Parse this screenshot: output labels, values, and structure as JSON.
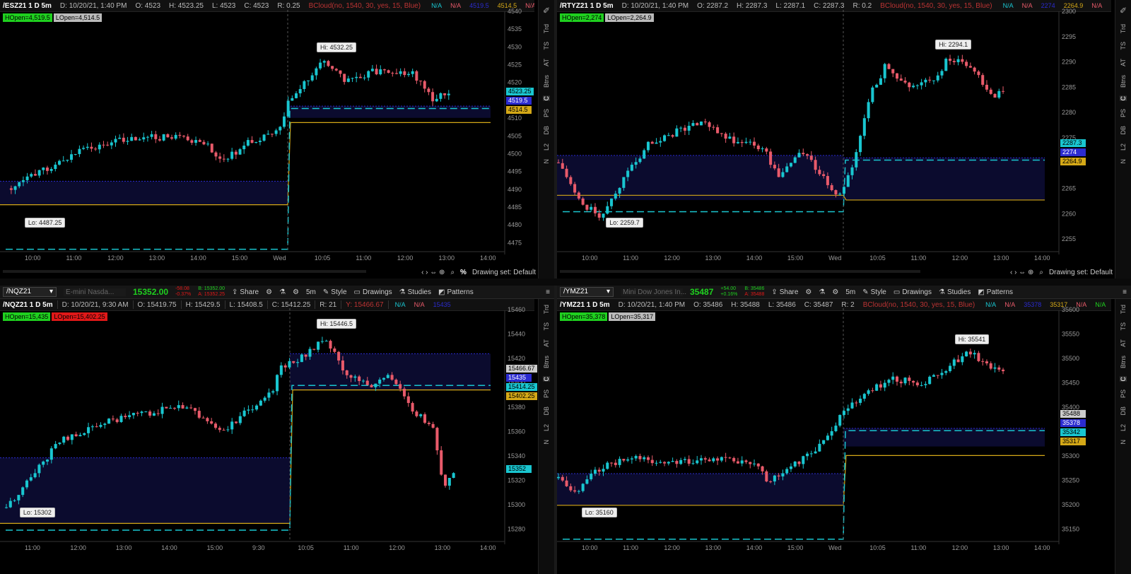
{
  "panels": [
    {
      "id": "es",
      "infobar": {
        "symbol": "/ESZ21 1 D 5m",
        "date": "D: 10/20/21, 1:40 PM",
        "open": "O: 4523",
        "high": "H: 4523.25",
        "low": "L: 4523",
        "close": "C: 4523",
        "range": "R: 0.25",
        "study": "BCloud(no, 1540, 30, yes, 15, Blue)",
        "na1": "N/A",
        "na2": "N/A",
        "val1": "4519.5",
        "val2": "4514.5",
        "na3": "N/A",
        "na4": "N/A",
        "na5": "N/A"
      },
      "badges": [
        {
          "text": "HOpen=4,519.5",
          "color": "#1fd01f"
        },
        {
          "text": "LOpen=4,514.5",
          "color": "#bbbbbb"
        }
      ],
      "y_ticks": [
        "4540",
        "4535",
        "4530",
        "4525",
        "4520",
        "4515",
        "4510",
        "4505",
        "4500",
        "4495",
        "4490",
        "4485",
        "4480",
        "4475"
      ],
      "x_ticks": [
        "10:00",
        "11:00",
        "12:00",
        "13:00",
        "14:00",
        "15:00",
        "Wed",
        "10:05",
        "11:00",
        "12:00",
        "13:00",
        "14:00"
      ],
      "hi_label": "Hi: 4532.25",
      "lo_label": "Lo: 4487.25",
      "price_labels": [
        {
          "text": "4523.25",
          "color": "#19c6d0"
        },
        {
          "text": "4519.5",
          "color": "#2b2bd0"
        },
        {
          "text": "4514.5",
          "color": "#d4a817"
        }
      ],
      "footer": {
        "drawing_set": "Drawing set: Default",
        "percent": "%"
      }
    },
    {
      "id": "rty",
      "infobar": {
        "symbol": "/RTYZ21 1 D 5m",
        "date": "D: 10/20/21, 1:40 PM",
        "open": "O: 2287.2",
        "high": "H: 2287.3",
        "low": "L: 2287.1",
        "close": "C: 2287.3",
        "range": "R: 0.2",
        "study": "BCloud(no, 1540, 30, yes, 15, Blue)",
        "na1": "N/A",
        "na2": "N/A",
        "val1": "2274",
        "val2": "2264.9",
        "na3": "N/A",
        "na4": "N/A",
        "na5": ""
      },
      "badges": [
        {
          "text": "HOpen=2,274",
          "color": "#1fd01f"
        },
        {
          "text": "LOpen=2,264.9",
          "color": "#bbbbbb"
        }
      ],
      "y_ticks": [
        "2300",
        "2295",
        "2290",
        "2285",
        "2280",
        "2275",
        "2270",
        "2265",
        "2260",
        "2255"
      ],
      "x_ticks": [
        "10:00",
        "11:00",
        "12:00",
        "13:00",
        "14:00",
        "15:00",
        "Wed",
        "10:05",
        "11:00",
        "12:00",
        "13:00",
        "14:00"
      ],
      "hi_label": "Hi: 2294.1",
      "lo_label": "Lo: 2259.7",
      "price_labels": [
        {
          "text": "2287.3",
          "color": "#19c6d0"
        },
        {
          "text": "2274",
          "color": "#2b2bd0"
        },
        {
          "text": "2264.9",
          "color": "#d4a817"
        }
      ],
      "footer": {
        "drawing_set": "Drawing set: Default",
        "percent": ""
      }
    },
    {
      "id": "nq",
      "toolbar": {
        "symbol": "/NQZ21",
        "description": "E-mini Nasda...",
        "last": "15352.00",
        "chg": "-58.08",
        "chg_pct": "-0.37%",
        "bid": "B: 15352.00",
        "ask": "A: 15352.25",
        "share": "Share",
        "style": "Style",
        "drawings": "Drawings",
        "studies": "Studies",
        "patterns": "Patterns",
        "timeframe": "5m"
      },
      "infobar": {
        "symbol": "/NQZ21 1 D 5m",
        "date": "D: 10/20/21, 9:30 AM",
        "open": "O: 15419.75",
        "high": "H: 15429.5",
        "low": "L: 15408.5",
        "close": "C: 15412.25",
        "range": "R: 21",
        "study": "Y: 15466.67",
        "na1": "N/A",
        "na2": "N/A",
        "val1": "15435",
        "val2": "",
        "na3": "",
        "na4": "",
        "na5": ""
      },
      "badges": [
        {
          "text": "HOpen=15,435",
          "color": "#1fd01f"
        },
        {
          "text": "LOpen=15,402.25",
          "color": "#e01818"
        }
      ],
      "y_ticks": [
        "15460",
        "15440",
        "15420",
        "15400",
        "15380",
        "15360",
        "15340",
        "15320",
        "15300",
        "15280"
      ],
      "x_ticks": [
        "11:00",
        "12:00",
        "13:00",
        "14:00",
        "15:00",
        "9:30",
        "10:05",
        "11:00",
        "12:00",
        "13:00",
        "14:00"
      ],
      "hi_label": "Hi: 15446.5",
      "lo_label": "Lo: 15302",
      "price_labels": [
        {
          "text": "15466.67",
          "color": "#cccccc"
        },
        {
          "text": "15435",
          "color": "#2b2bd0"
        },
        {
          "text": "15414.25",
          "color": "#19c6d0"
        },
        {
          "text": "15402.25",
          "color": "#d4a817"
        },
        {
          "text": "15352",
          "color": "#19c6d0"
        }
      ],
      "footer": {
        "drawing_set": "",
        "percent": ""
      }
    },
    {
      "id": "ym",
      "toolbar": {
        "symbol": "/YMZ21",
        "description": "Mini Dow Jones In...",
        "last": "35487",
        "chg": "+54.00",
        "chg_pct": "+0.16%",
        "bid": "B: 35486",
        "ask": "A: 35488",
        "share": "Share",
        "style": "Style",
        "drawings": "Drawings",
        "studies": "Studies",
        "patterns": "Patterns",
        "timeframe": "5m"
      },
      "infobar": {
        "symbol": "/YMZ21 1 D 5m",
        "date": "D: 10/20/21, 1:40 PM",
        "open": "O: 35486",
        "high": "H: 35488",
        "low": "L: 35486",
        "close": "C: 35487",
        "range": "R: 2",
        "study": "BCloud(no, 1540, 30, yes, 15, Blue)",
        "na1": "N/A",
        "na2": "N/A",
        "val1": "35378",
        "val2": "35317",
        "na3": "N/A",
        "na4": "N/A",
        "na5": "N/A"
      },
      "badges": [
        {
          "text": "HOpen=35,378",
          "color": "#1fd01f"
        },
        {
          "text": "LOpen=35,317",
          "color": "#bbbbbb"
        }
      ],
      "y_ticks": [
        "35600",
        "35550",
        "35500",
        "35450",
        "35400",
        "35350",
        "35300",
        "35250",
        "35200",
        "35150"
      ],
      "x_ticks": [
        "10:00",
        "11:00",
        "12:00",
        "13:00",
        "14:00",
        "15:00",
        "Wed",
        "10:05",
        "11:00",
        "12:00",
        "13:00",
        "14:00"
      ],
      "hi_label": "Hi: 35541",
      "lo_label": "Lo: 35160",
      "price_labels": [
        {
          "text": "35488",
          "color": "#cccccc"
        },
        {
          "text": "35378",
          "color": "#2b2bd0"
        },
        {
          "text": "35342",
          "color": "#19c6d0"
        },
        {
          "text": "35317",
          "color": "#d4a817"
        }
      ],
      "footer": {
        "drawing_set": "",
        "percent": ""
      }
    }
  ],
  "sidestrip": [
    "Trd",
    "TS",
    "AT",
    "Btns",
    "C",
    "PS",
    "DB",
    "L2",
    "N"
  ],
  "colors": {
    "up": "#19c6d0",
    "down": "#e85a6a",
    "cloud": "#0b0b2e",
    "hopen": "#2b2bd0",
    "lopen": "#d4a817",
    "dash": "#19c6d0"
  }
}
